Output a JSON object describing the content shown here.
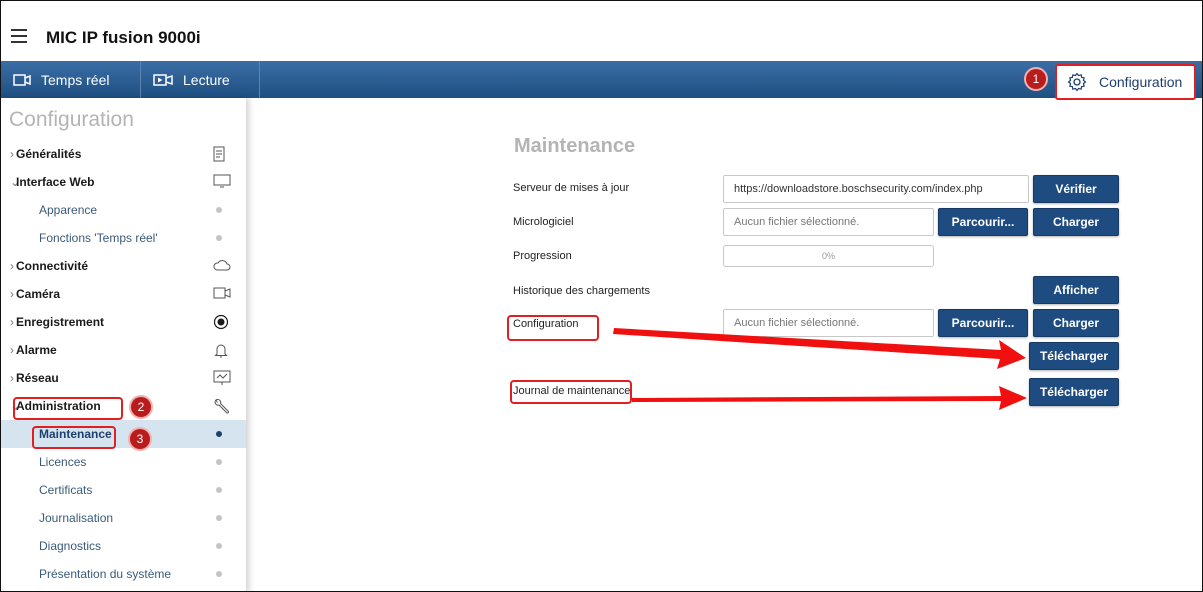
{
  "app": {
    "title": "MIC IP fusion 9000i"
  },
  "navbar": {
    "tabs": [
      {
        "label": "Temps réel",
        "icon": "camera-icon"
      },
      {
        "label": "Lecture",
        "icon": "playback-icon"
      }
    ],
    "config": {
      "label": "Configuration",
      "icon": "gear-icon"
    }
  },
  "annotations": {
    "badge1": "1",
    "badge2": "2",
    "badge3": "3",
    "color": "#e02020"
  },
  "sidebar": {
    "title": "Configuration",
    "items": [
      {
        "label": "Généralités",
        "type": "top",
        "icon": "document-icon"
      },
      {
        "label": "Interface Web",
        "type": "top",
        "icon": "monitor-icon"
      },
      {
        "label": "Apparence",
        "type": "sub"
      },
      {
        "label": "Fonctions 'Temps réel'",
        "type": "sub"
      },
      {
        "label": "Connectivité",
        "type": "top",
        "icon": "cloud-icon"
      },
      {
        "label": "Caméra",
        "type": "top",
        "icon": "camera-icon"
      },
      {
        "label": "Enregistrement",
        "type": "top",
        "icon": "record-icon"
      },
      {
        "label": "Alarme",
        "type": "top",
        "icon": "bell-icon"
      },
      {
        "label": "Réseau",
        "type": "top",
        "icon": "network-icon"
      },
      {
        "label": "Administration",
        "type": "top",
        "icon": "wrench-icon"
      },
      {
        "label": "Maintenance",
        "type": "sub",
        "active": true
      },
      {
        "label": "Licences",
        "type": "sub"
      },
      {
        "label": "Certificats",
        "type": "sub"
      },
      {
        "label": "Journalisation",
        "type": "sub"
      },
      {
        "label": "Diagnostics",
        "type": "sub"
      },
      {
        "label": "Présentation du système",
        "type": "sub"
      }
    ]
  },
  "main": {
    "title": "Maintenance",
    "update_server": {
      "label": "Serveur de mises à jour",
      "value": "https://downloadstore.boschsecurity.com/index.php",
      "verify_button": "Vérifier"
    },
    "firmware": {
      "label": "Micrologiciel",
      "placeholder": "Aucun fichier sélectionné.",
      "browse_button": "Parcourir...",
      "upload_button": "Charger"
    },
    "progress": {
      "label": "Progression",
      "value_text": "0%",
      "value": 0
    },
    "upload_history": {
      "label": "Historique des chargements",
      "show_button": "Afficher"
    },
    "configuration": {
      "label": "Configuration",
      "placeholder": "Aucun fichier sélectionné.",
      "browse_button": "Parcourir...",
      "upload_button": "Charger",
      "download_button": "Télécharger"
    },
    "maintenance_log": {
      "label": "Journal de maintenance",
      "download_button": "Télécharger"
    }
  }
}
